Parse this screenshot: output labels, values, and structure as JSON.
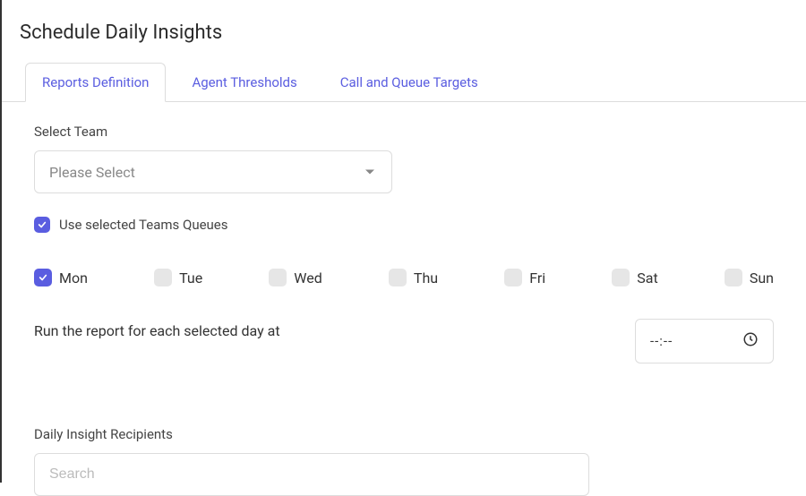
{
  "header": {
    "title": "Schedule Daily Insights"
  },
  "tabs": [
    {
      "id": "reports-definition",
      "label": "Reports Definition",
      "active": true
    },
    {
      "id": "agent-thresholds",
      "label": "Agent Thresholds",
      "active": false
    },
    {
      "id": "call-queue-targets",
      "label": "Call and Queue Targets",
      "active": false
    }
  ],
  "team": {
    "label": "Select Team",
    "placeholder": "Please Select"
  },
  "queues_checkbox": {
    "label": "Use selected Teams Queues",
    "checked": true
  },
  "days": [
    {
      "id": "mon",
      "label": "Mon",
      "checked": true
    },
    {
      "id": "tue",
      "label": "Tue",
      "checked": false
    },
    {
      "id": "wed",
      "label": "Wed",
      "checked": false
    },
    {
      "id": "thu",
      "label": "Thu",
      "checked": false
    },
    {
      "id": "fri",
      "label": "Fri",
      "checked": false
    },
    {
      "id": "sat",
      "label": "Sat",
      "checked": false
    },
    {
      "id": "sun",
      "label": "Sun",
      "checked": false
    }
  ],
  "run": {
    "text": "Run the report for each selected day at",
    "time_value": "--:--"
  },
  "recipients": {
    "label": "Daily Insight Recipients",
    "search_placeholder": "Search"
  }
}
